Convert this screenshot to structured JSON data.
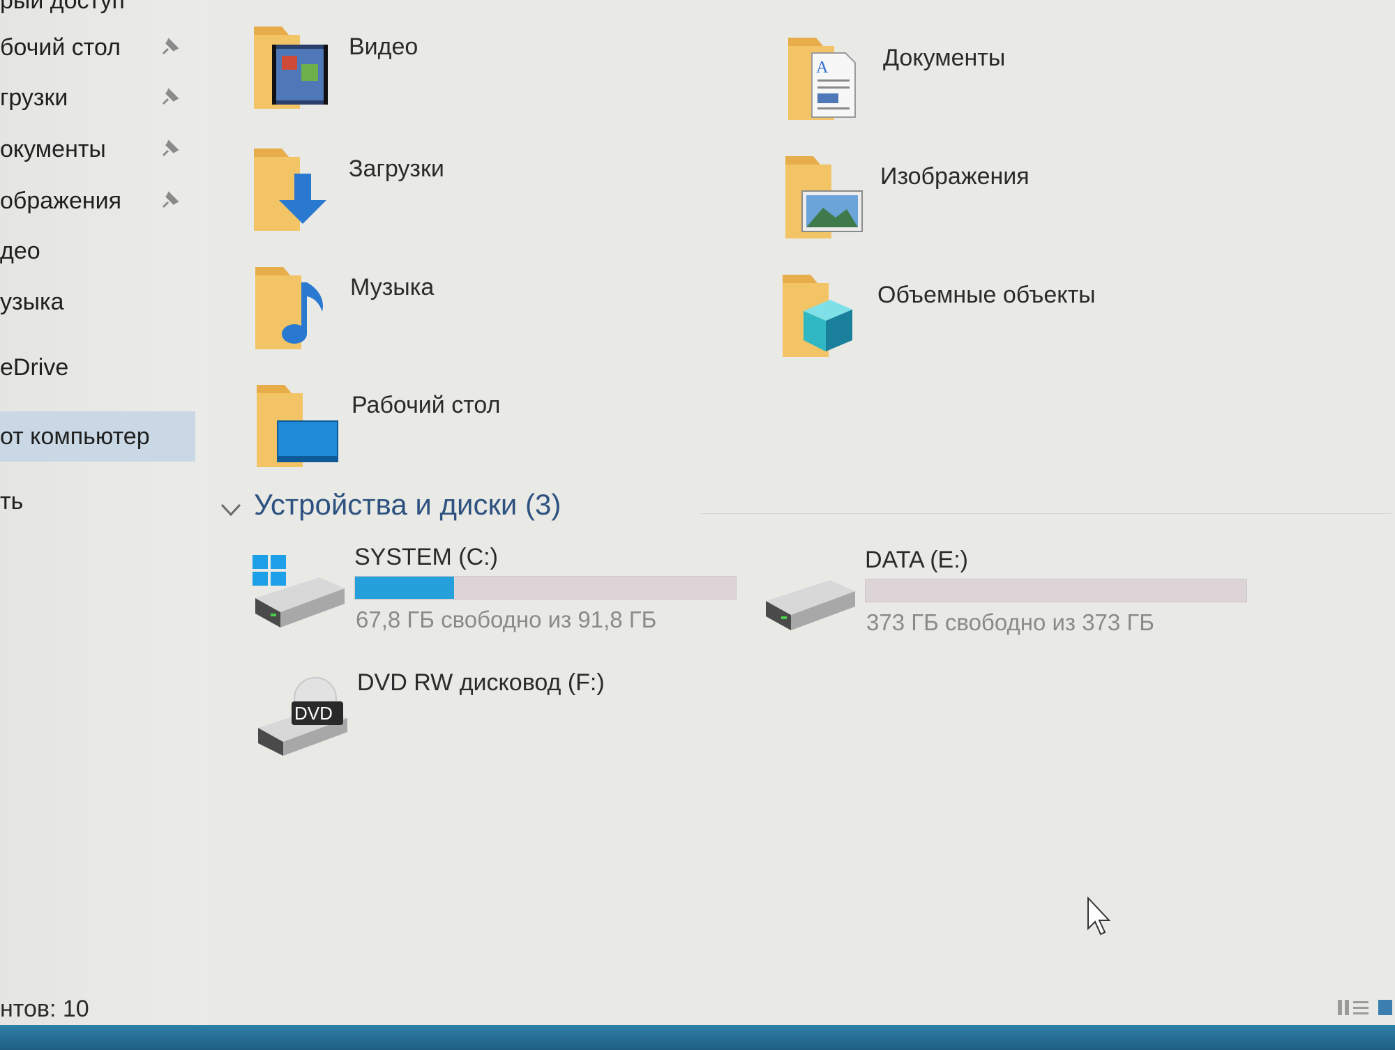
{
  "sidebar": {
    "items": [
      {
        "label": "рый доступ",
        "pinned": false
      },
      {
        "label": "бочий стол",
        "pinned": true
      },
      {
        "label": "грузки",
        "pinned": true
      },
      {
        "label": "окументы",
        "pinned": true
      },
      {
        "label": "ображения",
        "pinned": true
      },
      {
        "label": "део",
        "pinned": false
      },
      {
        "label": "узыка",
        "pinned": false
      },
      {
        "label": "eDrive",
        "pinned": false
      },
      {
        "label": "от компьютер",
        "pinned": false,
        "selected": true
      },
      {
        "label": "ть",
        "pinned": false
      }
    ],
    "pin_icon": "pin-icon"
  },
  "folders": [
    {
      "name": "Видео",
      "icon": "video-folder-icon"
    },
    {
      "name": "Документы",
      "icon": "documents-folder-icon"
    },
    {
      "name": "Загрузки",
      "icon": "downloads-folder-icon"
    },
    {
      "name": "Изображения",
      "icon": "pictures-folder-icon"
    },
    {
      "name": "Музыка",
      "icon": "music-folder-icon"
    },
    {
      "name": "Объемные объекты",
      "icon": "3d-objects-folder-icon"
    },
    {
      "name": "Рабочий стол",
      "icon": "desktop-folder-icon"
    }
  ],
  "devices_group": {
    "title": "Устройства и диски (3)",
    "drives": [
      {
        "name": "SYSTEM (C:)",
        "free_text": "67,8 ГБ свободно из 91,8 ГБ",
        "used_fraction": 0.26,
        "icon": "system-drive-icon"
      },
      {
        "name": "DATA (E:)",
        "free_text": "373 ГБ свободно из 373 ГБ",
        "used_fraction": 0.0,
        "icon": "hard-drive-icon"
      },
      {
        "name": "DVD RW дисковод (F:)",
        "icon": "dvd-drive-icon",
        "badge": "DVD"
      }
    ]
  },
  "status": {
    "item_count": "нтов: 10"
  },
  "colors": {
    "accent": "#26a0da",
    "selected": "#c9d8e4",
    "group_title": "#2e5280",
    "folder": "#f2c15f"
  }
}
